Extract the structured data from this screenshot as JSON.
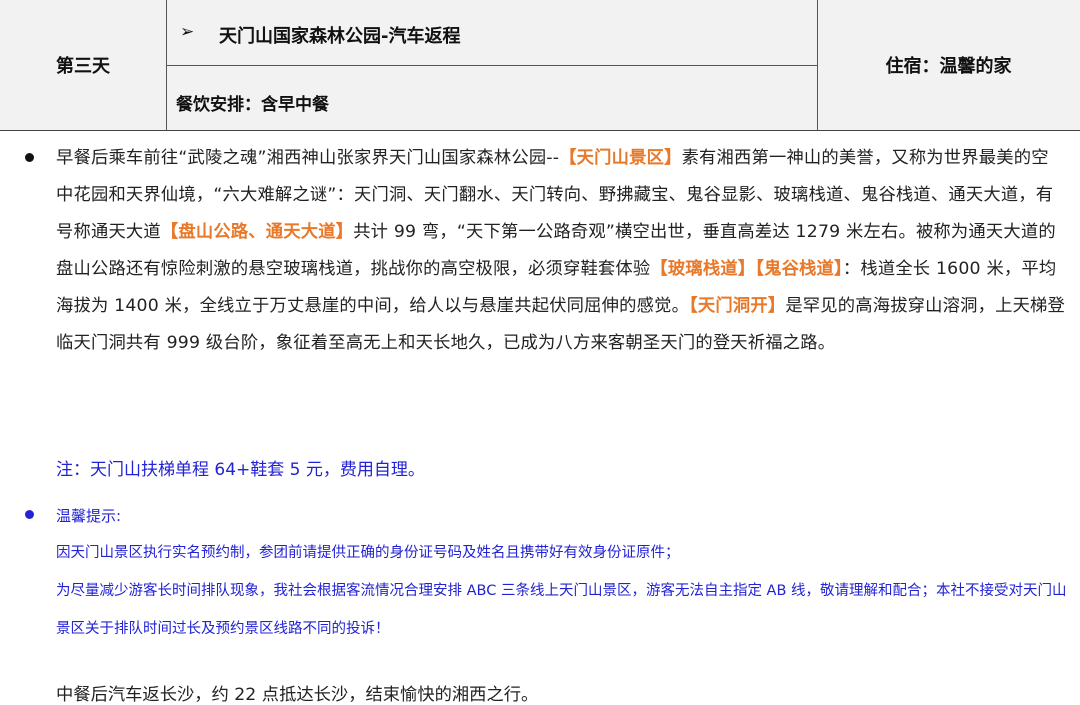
{
  "header": {
    "day": "第三天",
    "route_arrow": "➢",
    "route": "天门山国家森林公园-汽车返程",
    "meals": "餐饮安排：含早中餐",
    "lodging": "住宿：温馨的家"
  },
  "itinerary": {
    "segments": [
      {
        "t": "早餐后乘车前往“武陵之魂”湘西神山张家界天门山国家森林公园--",
        "hl": false
      },
      {
        "t": "【天门山景区】",
        "hl": true
      },
      {
        "t": "素有湘西第一神山的美誉，又称为世界最美的空中花园和天界仙境，“六大难解之谜”：天门洞、天门翻水、天门转向、野拂藏宝、鬼谷显影、玻璃栈道、鬼谷栈道、通天大道，有号称通天大道",
        "hl": false
      },
      {
        "t": "【盘山公路、通天大道】",
        "hl": true
      },
      {
        "t": "共计 99 弯，“天下第一公路奇观”横空出世，垂直高差达 1279 米左右。被称为通天大道的盘山公路还有惊险刺激的悬空玻璃栈道，挑战你的高空极限，必须穿鞋套体验",
        "hl": false
      },
      {
        "t": "【玻璃栈道】【鬼谷栈道】",
        "hl": true
      },
      {
        "t": "：栈道全长 1600 米，平均海拔为 1400 米，全线立于万丈悬崖的中间，给人以与悬崖共起伏同屈伸的感觉。",
        "hl": false
      },
      {
        "t": "【天门洞开】",
        "hl": true
      },
      {
        "t": "是罕见的高海拔穿山溶洞，上天梯登临天门洞共有 999 级台阶，象征着至高无上和天长地久，已成为八方来客朝圣天门的登天祈福之路。",
        "hl": false
      }
    ],
    "note": "注：天门山扶梯单程 64+鞋套 5 元，费用自理。"
  },
  "tips": {
    "title": "温馨提示:",
    "line1": "因天门山景区执行实名预约制，参团前请提供正确的身份证号码及姓名且携带好有效身份证原件；",
    "line2": "为尽量减少游客长时间排队现象，我社会根据客流情况合理安排 ABC 三条线上天门山景区，游客无法自主指定 AB 线，敬请理解和配合；本社不接受对天门山景区关于排队时间过长及预约景区线路不同的投诉！"
  },
  "closing": "中餐后汽车返长沙，约 22 点抵达长沙，结束愉快的湘西之行。",
  "colors": {
    "highlight": "#e8792a",
    "tip_blue": "#2323d6",
    "header_bg": "#f2f2f2"
  }
}
